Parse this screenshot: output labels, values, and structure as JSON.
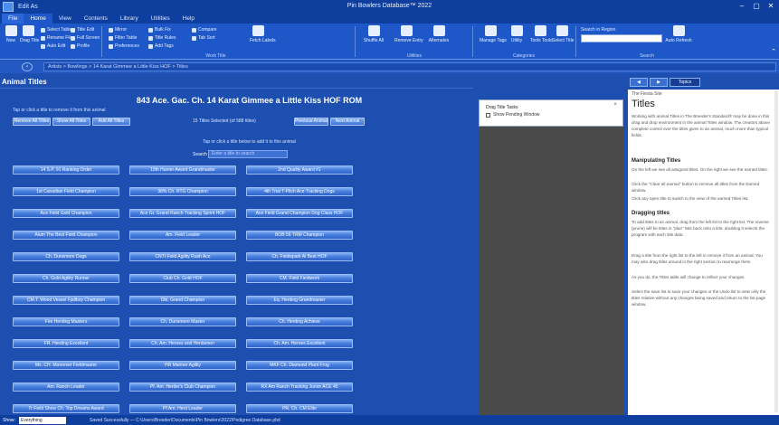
{
  "window": {
    "title": "Pin Bowlers Database™ 2022",
    "menu_label": "Edit As"
  },
  "ribbon": {
    "tabs": [
      "File",
      "Home",
      "View",
      "Contents",
      "Library",
      "Utilities",
      "Help"
    ],
    "groups": [
      {
        "label": ""
      },
      {
        "label": "Work Title"
      },
      {
        "label": "Utilities"
      },
      {
        "label": "Categories"
      },
      {
        "label": "Search"
      }
    ],
    "big_buttons": [
      "New",
      "Drag Title",
      "Fetch Labels",
      "Shuffle All",
      "Remove Entry",
      "Alternates",
      "Manage Tags",
      "Utility",
      "Tools Tools",
      "Select Title",
      "Auto Refresh"
    ],
    "small_buttons": [
      "Select Table",
      "Rename File",
      "Auto Edit",
      "Title Edit",
      "Full Screen",
      "Profile",
      "Mirror",
      "Filter Table",
      "Preferences",
      "Bulk Fix",
      "Title Rules",
      "Add Tags",
      "Compare",
      "Tab Sort"
    ],
    "search_label": "Search in Region"
  },
  "pathbar": {
    "back_glyph": "‹",
    "path": "Artists > Bowlings > 14 Karat Gimmee a Little Kiss HOF > Titles"
  },
  "left_pane": {
    "title": "Animal Titles",
    "game_title": "843 Ace. Gac. Ch. 14 Karat Gimmee a Little Kiss HOF ROM",
    "instruction1": "Tap or click a title to remove it from this animal",
    "top_buttons": [
      "Remove All Titles",
      "Show All Titles",
      "Add All Titles"
    ],
    "title_count": "15 Titles Selected (of 588 titles)",
    "right_buttons": [
      "Previous Animal",
      "Next Animal"
    ],
    "instruction2": "Tap or click a title below to add it to this animal",
    "search_label": "Search",
    "search_placeholder": "Enter a title to search",
    "titles": [
      "14 S.P. 91 Ranking Order",
      "19th Hunter Award Grandmaster",
      "2nd Quality Award #1",
      "1st Canadian Field Champion",
      "38% Ch. RTG Champion",
      "4th Trial T-Pitch Ace Tracking Dogs",
      "Ace Field Gold Champion",
      "Ace Gr. Grand Ranch Tracking Sprint HOF",
      "Ace Field Grand Champion Dog Class HOF",
      "Alum The Best Field Champion",
      "Am. Field Leader",
      "BOB 56 TRM Champion",
      "Ch. Dunsmere Dogs",
      "CNTI Field Agility Rush Ace",
      "Ch. Fieldspark Al Best HOF",
      "Ch. Gold Agility Runner",
      "Club Ch. Gold HOF",
      "CM. Field Fieldwork",
      "CM.T. Wood Vessel Fjallboy Champion",
      "Dbl. Grand Champion",
      "Eq. Herding Grandmaster",
      "Fire Herding Masters",
      "Ch. Dunsmere Master",
      "Ch. Herding Achieve",
      "FR. Herding Excellent",
      "Ch. Am. Heroes and Herdsmen",
      "Ch. Am. Heroes Excellent",
      "Mx. CH. Moreover Fieldmaster",
      "HR Mariner Agility",
      "MKF Ch. Diamond Plant Frog",
      "Am. Ranch Leader",
      "Pf. Am. Herder's Club Champion",
      "RX Am Ranch Tracking Junior ACE 45",
      "Tr Field Show Ch. Top Dreams Award",
      "Pf Am. Herd Leader",
      "PR. Ch. CM Elite"
    ]
  },
  "tasks_panel": {
    "title": "Drag Title Tasks",
    "close_glyph": "×",
    "checkbox_label": "Show Pending Window"
  },
  "help_pane": {
    "tabs": [
      "◀",
      "▶",
      "Topics"
    ],
    "crumb": "The Fiesta Site",
    "heading": "Titles",
    "para1": "Working with animal Titles in The Breeder's Standard® may be done in this drag and drop environment in the animal Titles window. The creators above complete control over the titles given to an animal, much more than typical fields.",
    "sub1": "Manipulating Titles",
    "para2": "On the left we see all assigned titles. On the right we see the earned titles.",
    "para3": "Click the \"Clear all earned\" button to remove all titles from the Earned window.",
    "para4": "Click any open title to switch to the view of the earned Titles list.",
    "sub2": "Dragging titles",
    "para5": "To add titles to an animal, drag from the left list to the right list. The reverse (prune) will be titles in \"plan\" lists back onto a title; doubling it selects the program with each title data.",
    "para6": "Drag a title from the right list to the left to remove it from an animal. You may also drag titles around in the right section to rearrange them.",
    "para7": "As you do, the Titles table will change to reflect your changes.",
    "para8": "Select the save list to save your changes or the Undo list to view only the titles relative without any changes being saved and return to the list page window."
  },
  "statusbar": {
    "label": "Show:",
    "select_value": "Everything",
    "text": "Saved Successfully — C:\\Users\\Breeder\\Documents\\Pin Bowlers\\2022\\Pedigree Database.pbd"
  },
  "colors": {
    "accent": "#1c4fb0",
    "button_top": "#82aef2",
    "button_bottom": "#2e63c8",
    "dark_panel": "#4a4a4a"
  }
}
